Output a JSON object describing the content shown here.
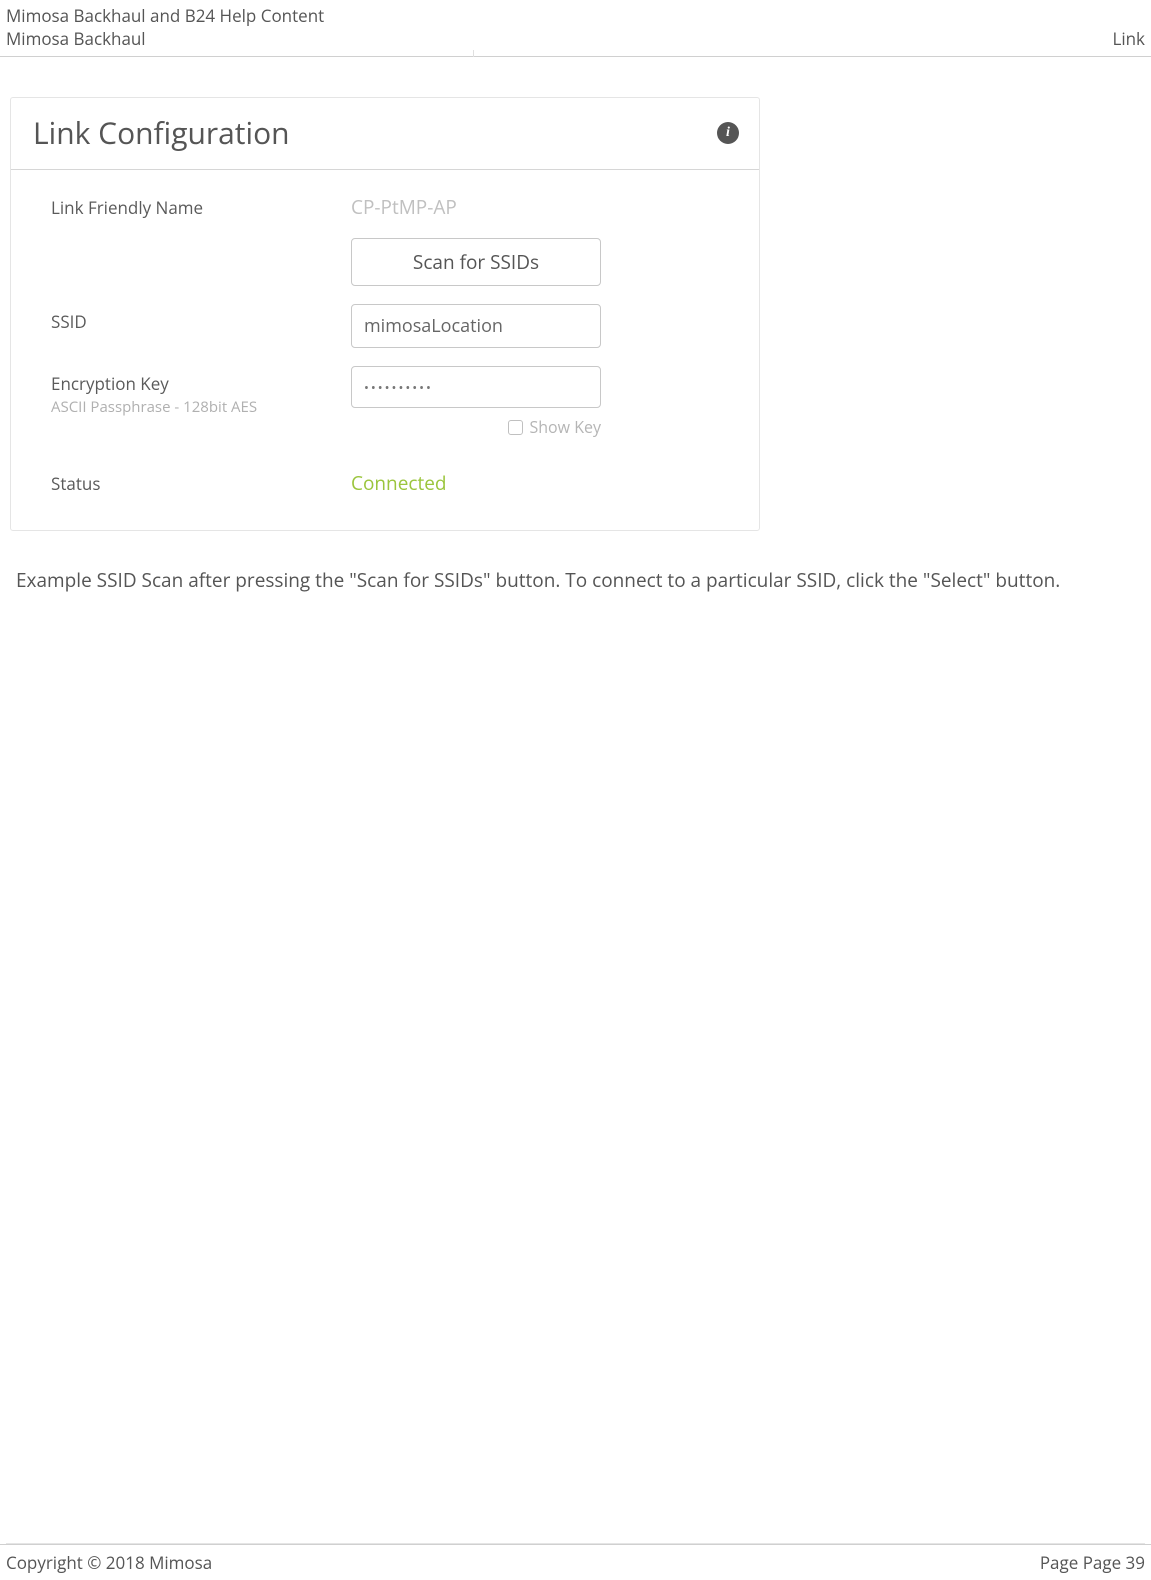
{
  "header": {
    "line1": "Mimosa Backhaul and B24 Help Content",
    "line2_left": "Mimosa Backhaul",
    "line2_right": "Link"
  },
  "panel": {
    "title": "Link Configuration",
    "info_glyph": "i",
    "fields": {
      "friendly_name": {
        "label": "Link Friendly Name",
        "value": "CP-PtMP-AP"
      },
      "scan_button": "Scan for SSIDs",
      "ssid": {
        "label": "SSID",
        "value": "mimosaLocation"
      },
      "encryption": {
        "label": "Encryption Key",
        "sublabel": "ASCII Passphrase - 128bit AES",
        "value_masked": "••••••••••",
        "show_key_label": "Show Key"
      },
      "status": {
        "label": "Status",
        "value": "Connected"
      }
    }
  },
  "caption": "Example SSID Scan after pressing the \"Scan for SSIDs\" button. To connect to a particular SSID, click the \"Select\" button.",
  "footer": {
    "copyright": "Copyright © 2018 Mimosa",
    "page": "Page Page 39"
  }
}
